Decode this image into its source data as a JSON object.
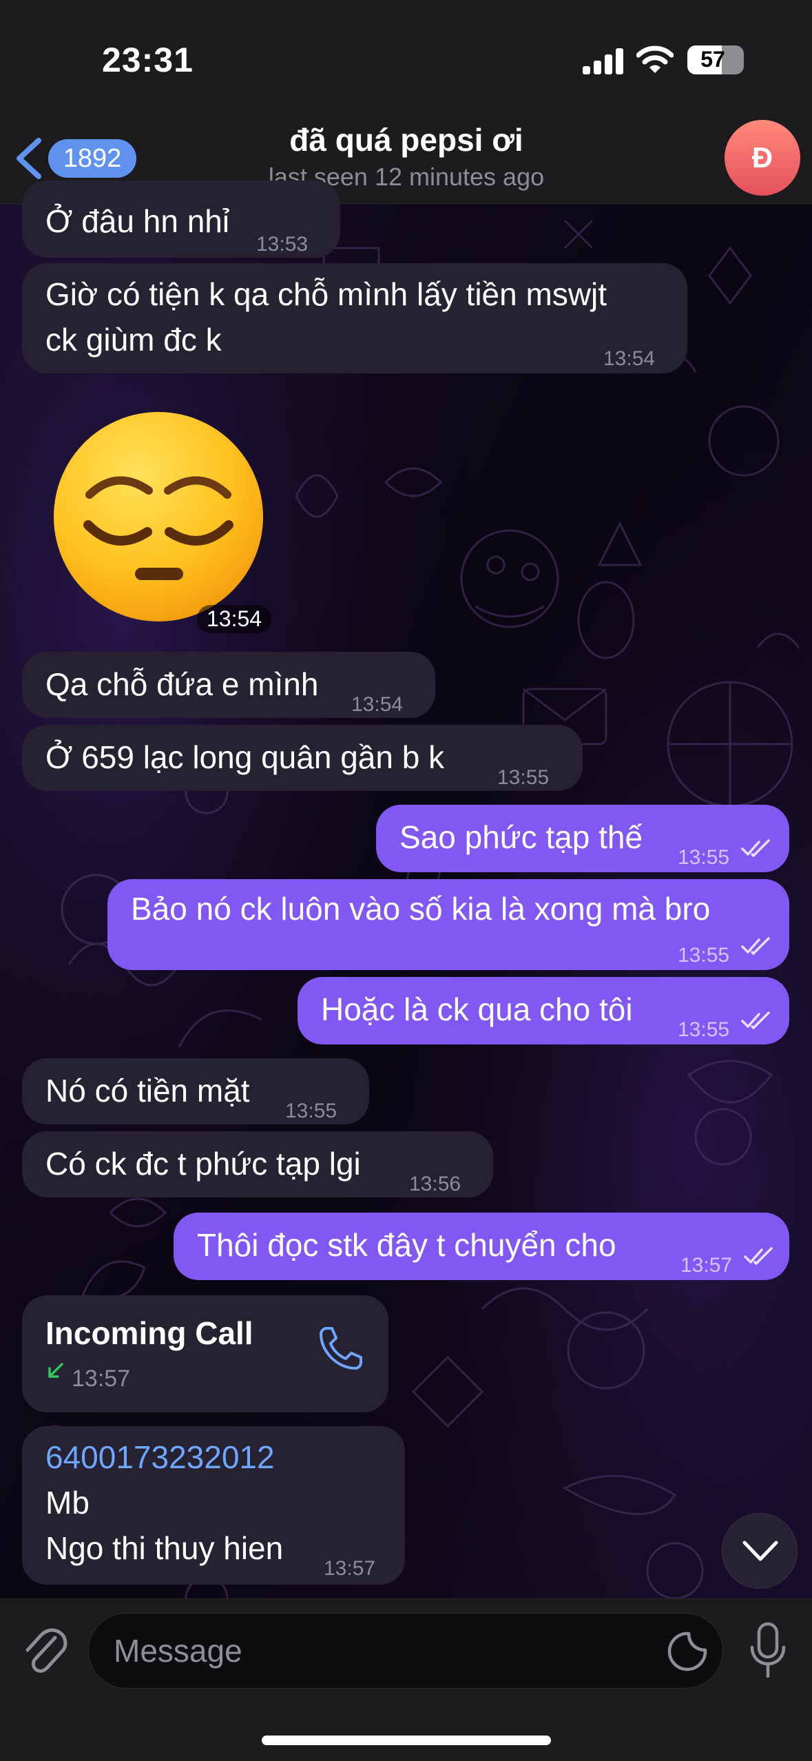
{
  "status_bar": {
    "time": "23:31",
    "battery": "57"
  },
  "header": {
    "back_badge": "1892",
    "title": "đã quá pepsi ơi",
    "subtitle": "last seen 12 minutes ago",
    "avatar_initial": "Đ"
  },
  "messages": [
    {
      "dir": "in",
      "text": "Ở đâu hn nhỉ",
      "time": "13:53"
    },
    {
      "dir": "in",
      "text": "Giờ có tiện k qa chỗ mình lấy tiền mswjt ck giùm đc k",
      "text_line1": "Giờ có tiện k qa chỗ mình lấy tiền mswjt",
      "text_line2": "ck giùm đc k",
      "time": "13:54"
    },
    {
      "dir": "in",
      "type": "sticker",
      "sticker": "pensive-face",
      "time": "13:54"
    },
    {
      "dir": "in",
      "text": "Qa chỗ đứa e mình",
      "time": "13:54"
    },
    {
      "dir": "in",
      "text": "Ở 659 lạc long quân gần b k",
      "time": "13:55"
    },
    {
      "dir": "out",
      "text": "Sao phức tạp thế",
      "time": "13:55",
      "read": true
    },
    {
      "dir": "out",
      "text": "Bảo nó ck luôn vào số kia là xong mà bro",
      "time": "13:55",
      "read": true
    },
    {
      "dir": "out",
      "text": "Hoặc là ck qua cho tôi",
      "time": "13:55",
      "read": true
    },
    {
      "dir": "in",
      "text": "Nó có tiền mặt",
      "time": "13:55"
    },
    {
      "dir": "in",
      "text": "Có ck đc t phức tạp lgi",
      "time": "13:56"
    },
    {
      "dir": "out",
      "text": "Thôi đọc stk đây t chuyển cho",
      "time": "13:57",
      "read": true
    },
    {
      "dir": "in",
      "type": "call",
      "title": "Incoming Call",
      "time": "13:57"
    },
    {
      "dir": "in",
      "lines": [
        "6400173232012",
        "Mb",
        "Ngo thi thuy hien"
      ],
      "time": "13:57"
    }
  ],
  "input": {
    "placeholder": "Message"
  },
  "colors": {
    "outgoing_bubble": "#8159f2",
    "incoming_bubble": "#262232",
    "link": "#6fa6ff",
    "call_arrow": "#34c759",
    "avatar": "#e5505c",
    "back_badge": "#5f93ee"
  },
  "icons": [
    "back-chevron-icon",
    "attach-icon",
    "sticker-icon",
    "microphone-icon",
    "phone-icon",
    "chevron-down-icon",
    "signal-icon",
    "wifi-icon",
    "battery-icon"
  ]
}
